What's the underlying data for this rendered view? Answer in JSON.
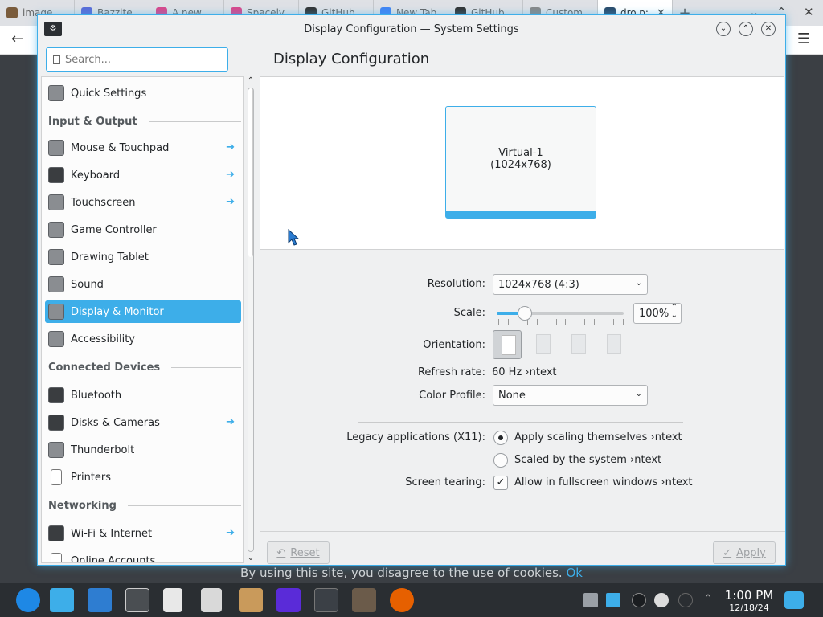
{
  "browser": {
    "tabs": [
      {
        "label": "image",
        "color": "#7a5c3c"
      },
      {
        "label": "Bazzite",
        "color": "#5a6cd8"
      },
      {
        "label": "A new",
        "color": "#d9478b"
      },
      {
        "label": "Spacely",
        "color": "#d9478b"
      },
      {
        "label": "GitHub",
        "color": "#333333"
      },
      {
        "label": "New Tab",
        "color": "#4285f4"
      },
      {
        "label": "GitHub",
        "color": "#333333"
      },
      {
        "label": "Custom",
        "color": "#888888"
      },
      {
        "label": "dro.p:",
        "color": "#2a4a6a"
      }
    ],
    "tab_close": "✕",
    "new_tab": "+",
    "back": "←",
    "menu": "☰",
    "ctrl_down": "⌄",
    "ctrl_min": "✕",
    "ctrl_up": "⌃",
    "ctrl_close": "✕"
  },
  "window": {
    "title": "Display Configuration — System Settings",
    "btn_down": "⌄",
    "btn_up": "⌃",
    "btn_close": "✕"
  },
  "sidebar": {
    "search_placeholder": "Search...",
    "scroll_up": "⌃",
    "scroll_down": "⌄",
    "arrow": "➔",
    "items": [
      {
        "label": "Quick Settings"
      },
      {
        "section": "Input & Output"
      },
      {
        "label": "Mouse & Touchpad",
        "arrow": true
      },
      {
        "label": "Keyboard",
        "arrow": true
      },
      {
        "label": "Touchscreen",
        "arrow": true
      },
      {
        "label": "Game Controller"
      },
      {
        "label": "Drawing Tablet"
      },
      {
        "label": "Sound"
      },
      {
        "label": "Display & Monitor",
        "selected": true
      },
      {
        "label": "Accessibility"
      },
      {
        "section": "Connected Devices"
      },
      {
        "label": "Bluetooth"
      },
      {
        "label": "Disks & Cameras",
        "arrow": true
      },
      {
        "label": "Thunderbolt"
      },
      {
        "label": "Printers"
      },
      {
        "section": "Networking"
      },
      {
        "label": "Wi-Fi & Internet",
        "arrow": true
      },
      {
        "label": "Online Accounts"
      }
    ]
  },
  "main": {
    "title": "Display Configuration",
    "monitor": {
      "name": "Virtual-1",
      "resolution": "(1024x768)"
    },
    "labels": {
      "resolution": "Resolution:",
      "scale": "Scale:",
      "orientation": "Orientation:",
      "refresh": "Refresh rate:",
      "color_profile": "Color Profile:",
      "legacy": "Legacy applications (X11):",
      "tearing": "Screen tearing:"
    },
    "resolution_value": "1024x768 (4:3)",
    "scale_value": "100%",
    "scale_fraction": 0.22,
    "refresh_value": "60 Hz ›ntext",
    "color_profile_value": "None",
    "legacy_option1": "Apply scaling themselves ›ntext",
    "legacy_option2": "Scaled by the system ›ntext",
    "tearing_option": "Allow in fullscreen windows ›ntext",
    "reset_label": "Reset",
    "apply_label": "Apply",
    "chevron": "⌄",
    "spin_up": "⌃",
    "spin_down": "⌄",
    "check": "✓",
    "reset_icon": "↶",
    "apply_icon": "✓"
  },
  "cookie": {
    "text": "By using this site, you disagree to the use of cookies. ",
    "ok": "Ok"
  },
  "taskbar": {
    "time": "1:00 PM",
    "date": "12/18/24"
  },
  "colors": {
    "accent": "#3daee9",
    "window_bg": "#eff0f1",
    "taskbar": "#2a2e32"
  }
}
